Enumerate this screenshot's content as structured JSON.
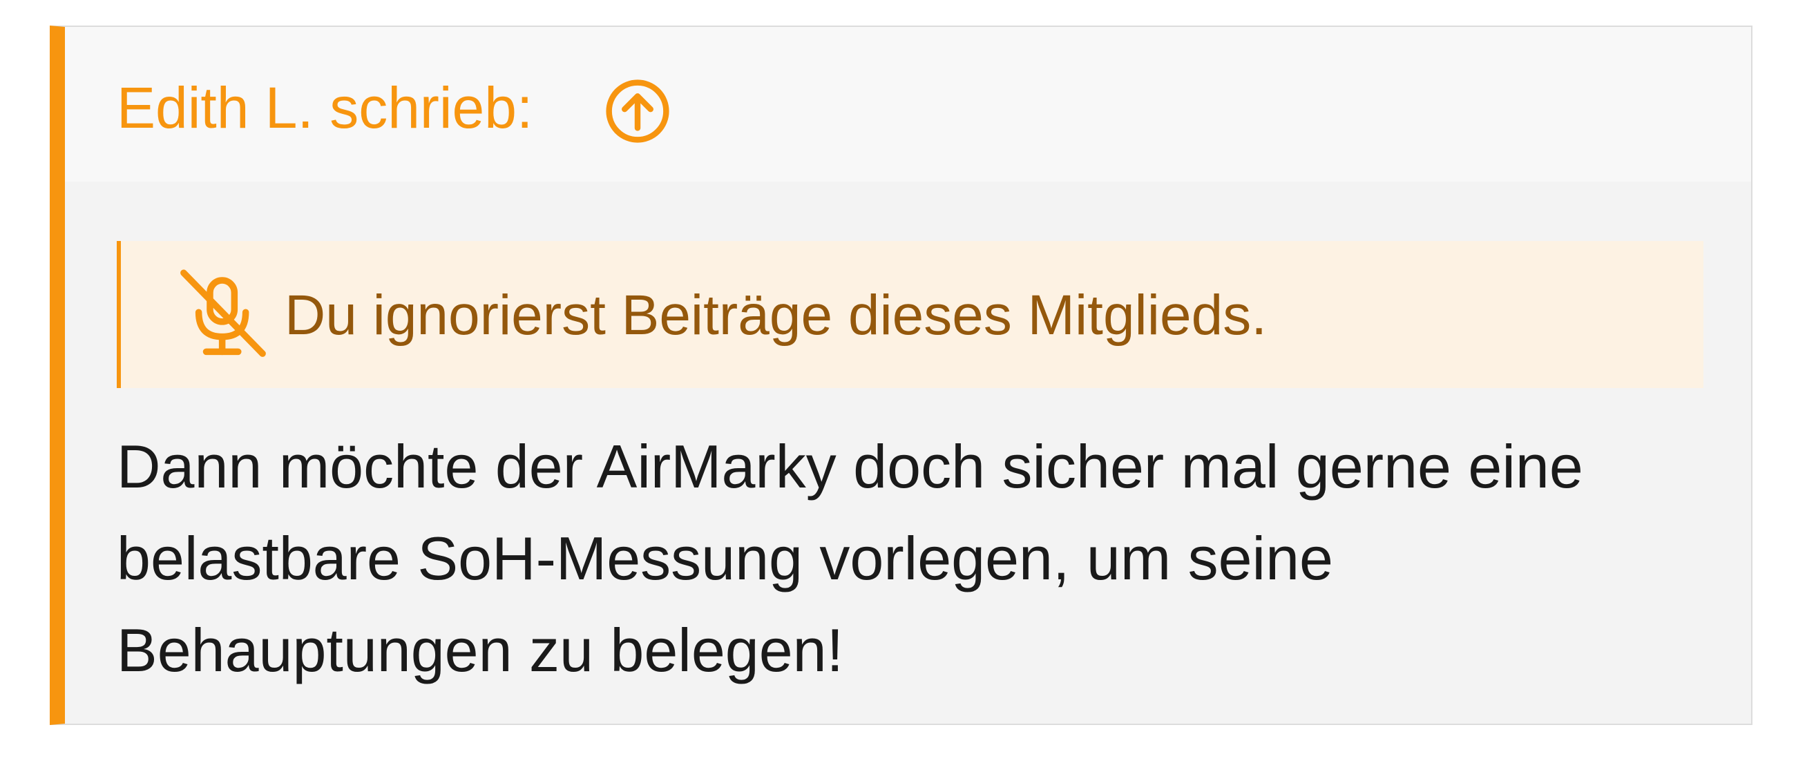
{
  "quote": {
    "author_label": "Edith L. schrieb:",
    "jump_icon": "arrow-circle-up-icon",
    "ignored_notice": {
      "icon": "microphone-slash-icon",
      "text": "Du ignorierst Beiträge dieses Mitglieds."
    },
    "body": "Dann möchte der AirMarky doch sicher mal gerne eine belastbare SoH-Messung vorlegen, um seine Behauptungen zu belegen!"
  },
  "colors": {
    "accent": "#f7950f",
    "notice_text": "#94580c",
    "notice_bg": "#fdf2e3",
    "quote_bg": "#f3f3f3",
    "header_bg": "#f8f8f8",
    "body_text": "#1a1a1a"
  }
}
